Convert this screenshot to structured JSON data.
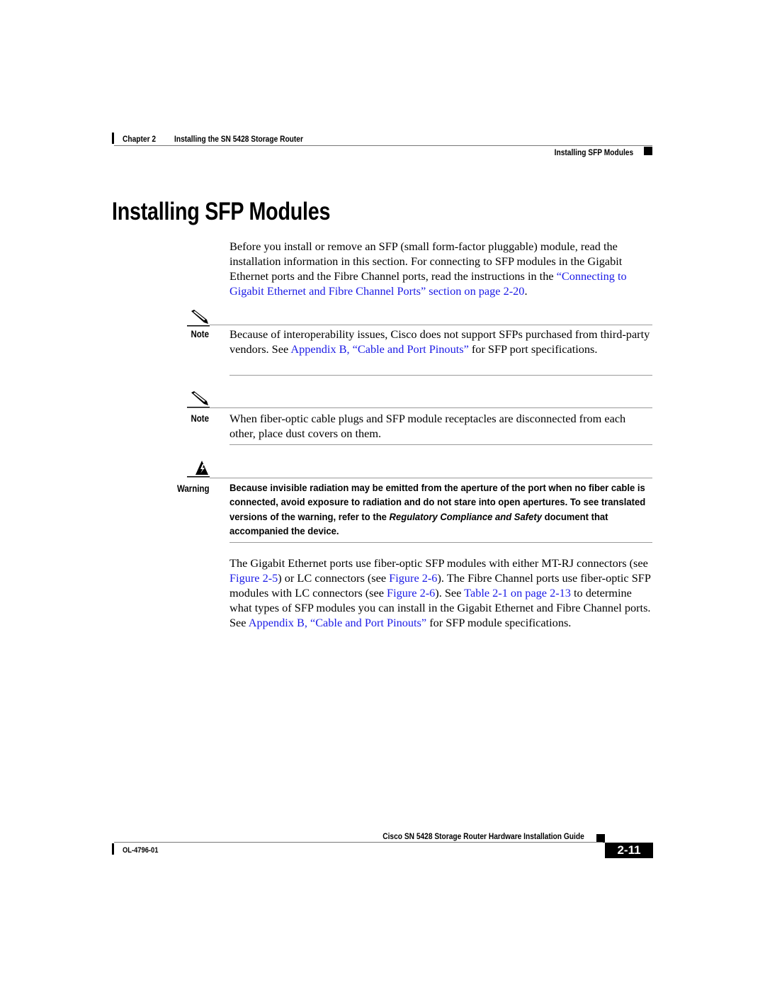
{
  "header": {
    "chapter": "Chapter 2",
    "chapter_title": "Installing the SN 5428 Storage Router",
    "section": "Installing SFP Modules"
  },
  "page_title": "Installing SFP Modules",
  "intro": {
    "text_before": "Before you install or remove an SFP (small form-factor pluggable) module, read the installation information in this section. For connecting to SFP modules in the Gigabit Ethernet ports and the Fibre Channel ports, read the instructions in the ",
    "link": "“Connecting to Gigabit Ethernet and Fibre Channel Ports” section on page 2-20",
    "text_after": "."
  },
  "note1": {
    "icon": "pencil-icon",
    "label": "Note",
    "text_before": "Because of interoperability issues, Cisco does not support SFPs purchased from third-party vendors. See ",
    "link": "Appendix B, “Cable and Port Pinouts”",
    "text_after": " for SFP port specifications."
  },
  "note2": {
    "icon": "pencil-icon",
    "label": "Note",
    "text": "When fiber-optic cable plugs and SFP module receptacles are disconnected from each other, place dust covers on them."
  },
  "warning": {
    "icon": "warning-lightning-icon",
    "label": "Warning",
    "text_before": "Because invisible radiation may be emitted from the aperture of the port when no fiber cable is connected, avoid exposure to radiation and do not stare into open apertures. To see translated versions of the warning, refer to the ",
    "italic": "Regulatory Compliance and Safety",
    "text_after": " document that accompanied the device."
  },
  "body2": {
    "t1": "The Gigabit Ethernet ports use fiber-optic SFP modules with either MT-RJ connectors (see ",
    "l1": "Figure 2-5",
    "t2": ") or LC connectors (see ",
    "l2": "Figure 2-6",
    "t3": "). The Fibre Channel ports use fiber-optic SFP modules with LC connectors (see ",
    "l3": "Figure 2-6",
    "t4": "). See ",
    "l4": "Table 2-1 on page 2-13",
    "t5": " to determine what types of SFP modules you can install in the Gigabit Ethernet and Fibre Channel ports. See ",
    "l5": "Appendix B, “Cable and Port Pinouts”",
    "t6": " for SFP module specifications."
  },
  "footer": {
    "guide_title": "Cisco SN 5428 Storage Router Hardware Installation Guide",
    "doc_number": "OL-4796-01",
    "page_number": "2-11"
  },
  "colors": {
    "link": "#1a1ae6",
    "rule": "#9a9a9a",
    "text": "#000000"
  }
}
